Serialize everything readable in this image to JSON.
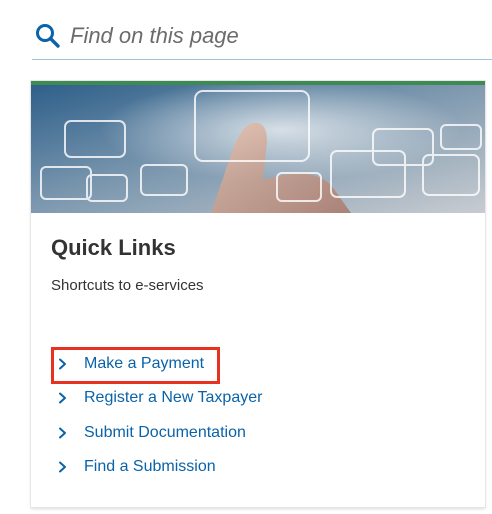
{
  "search": {
    "placeholder": "Find on this page",
    "icon": "search-icon"
  },
  "card": {
    "accent_color": "#3d8a53",
    "title": "Quick Links",
    "subtitle": "Shortcuts to e-services",
    "links": [
      {
        "label": "Make a Payment",
        "highlighted": true
      },
      {
        "label": "Register a New Taxpayer",
        "highlighted": false
      },
      {
        "label": "Submit Documentation",
        "highlighted": false
      },
      {
        "label": "Find a Submission",
        "highlighted": false
      }
    ],
    "link_color": "#0a63a9",
    "highlight_color": "#e8321f",
    "link_icon": "chevron-right-icon"
  }
}
